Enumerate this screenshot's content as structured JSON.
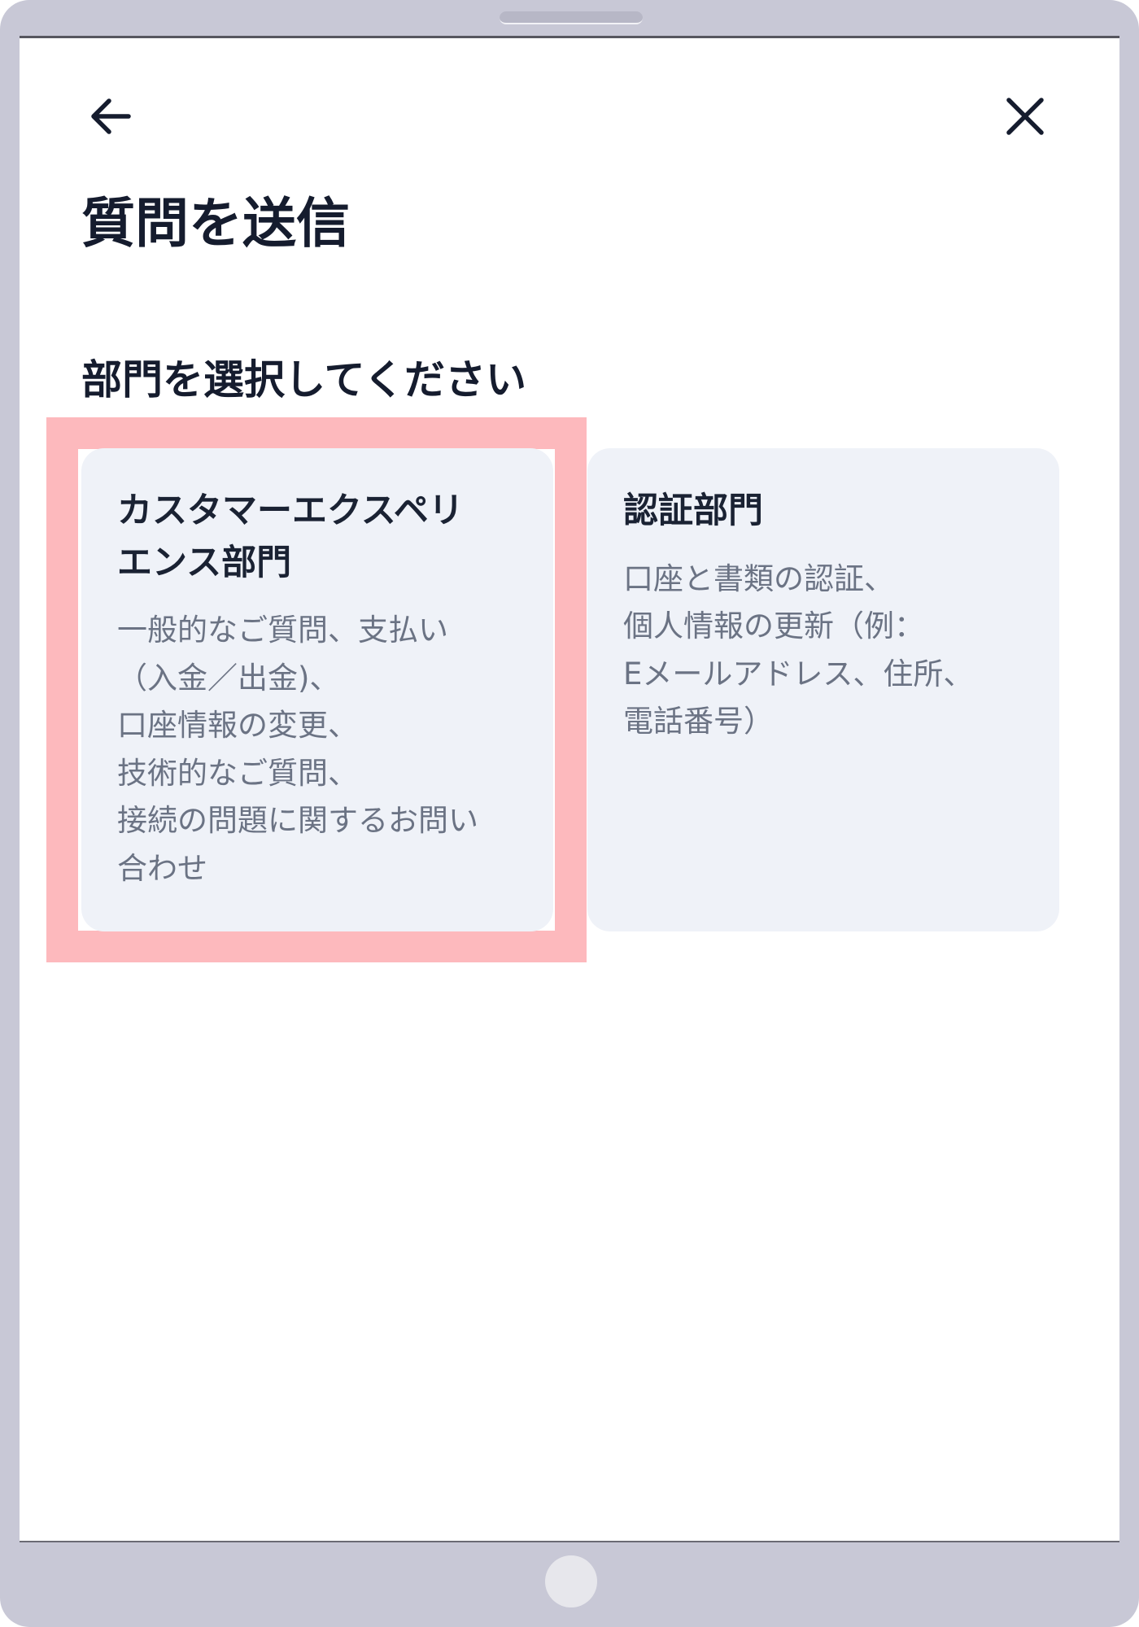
{
  "header": {
    "back_icon": "arrow-left-icon",
    "close_icon": "close-icon"
  },
  "page": {
    "title": "質問を送信",
    "section_label": "部門を選択してください"
  },
  "departments": [
    {
      "title_lines": [
        "カスタマーエクスペリ",
        "エンス部門"
      ],
      "description_lines": [
        "一般的なご質問、支払い",
        "（入金／出金)、",
        "口座情報の変更、",
        "技術的なご質問、",
        "接続の問題に関するお問い",
        "合わせ"
      ],
      "highlighted": true
    },
    {
      "title_lines": [
        "認証部門"
      ],
      "description_lines": [
        "口座と書類の認証、",
        "個人情報の更新（例：",
        "Eメールアドレス、住所、",
        "電話番号）"
      ],
      "highlighted": false
    }
  ],
  "colors": {
    "highlight": "#fdb9bd",
    "card_background": "#eff2f8",
    "title_text": "#151c2e",
    "description_text": "#6b7384",
    "device_frame": "#c8c8d6"
  }
}
